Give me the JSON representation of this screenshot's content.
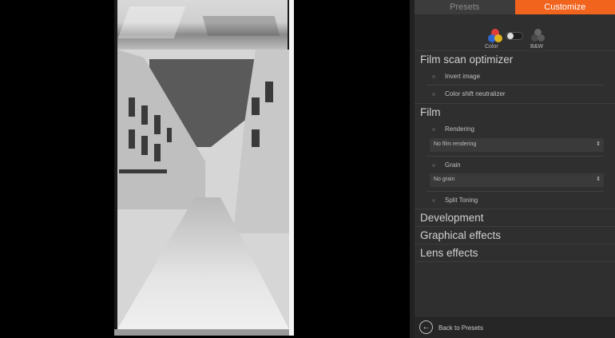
{
  "tabs": [
    {
      "label": "Presets",
      "active": false
    },
    {
      "label": "Customize",
      "active": true
    }
  ],
  "mode": {
    "color_label": "Color",
    "bw_label": "B&W",
    "toggle_state": "color",
    "color_icon": "rgb-circles-icon",
    "bw_icon": "grey-circles-icon"
  },
  "sections": {
    "film_scan_optimizer": {
      "title": "Film scan optimizer",
      "items": [
        "Invert image",
        "Color shift neutralizer"
      ]
    },
    "film": {
      "title": "Film",
      "rendering_label": "Rendering",
      "rendering_value": "No film rendering",
      "grain_label": "Grain",
      "grain_value": "No grain",
      "split_toning_label": "Split Toning"
    },
    "development": {
      "title": "Development"
    },
    "graphical_effects": {
      "title": "Graphical effects"
    },
    "lens_effects": {
      "title": "Lens effects"
    }
  },
  "footer": {
    "back_label": "Back to Presets",
    "back_icon": "back-arrow-icon"
  },
  "colors": {
    "accent": "#f0641e",
    "panel_bg": "#2f2f2f",
    "canvas_bg": "#000000"
  }
}
